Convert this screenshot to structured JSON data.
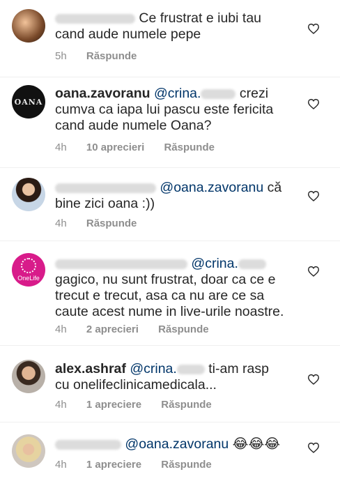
{
  "comments": [
    {
      "user": "",
      "text": "Ce frustrat e iubi tau cand aude numele pepe",
      "time": "5h",
      "likes": "",
      "reply": "Răspunde"
    },
    {
      "user": "oana.zavoranu",
      "mention": "@crina.",
      "text": "crezi cumva ca iapa lui pascu este fericita cand aude numele Oana?",
      "time": "4h",
      "likes": "10 aprecieri",
      "reply": "Răspunde",
      "avatar_text": "OANA"
    },
    {
      "user": "",
      "mention": "@oana.zavoranu",
      "text": "că bine zici oana :))",
      "time": "4h",
      "likes": "",
      "reply": "Răspunde"
    },
    {
      "user": "",
      "mention": "@crina.",
      "text": "gagico, nu sunt frustrat, doar ca ce e trecut e trecut, asa ca nu are ce sa caute acest nume  in live-urile noastre.",
      "time": "4h",
      "likes": "2 aprecieri",
      "reply": "Răspunde",
      "avatar_text": "OneLife"
    },
    {
      "user": "alex.ashraf",
      "mention": "@crina.",
      "text": "ti-am rasp cu onelifeclinicamedicala...",
      "time": "4h",
      "likes": "1 apreciere",
      "reply": "Răspunde"
    },
    {
      "user": "",
      "mention": "@oana.zavoranu",
      "text": "😂😂😂",
      "time": "4h",
      "likes": "1 apreciere",
      "reply": "Răspunde"
    }
  ],
  "icons": {
    "like": "heart-outline-icon"
  },
  "colors": {
    "mention": "#003569",
    "meta": "#8e8e8e",
    "text": "#262626"
  }
}
